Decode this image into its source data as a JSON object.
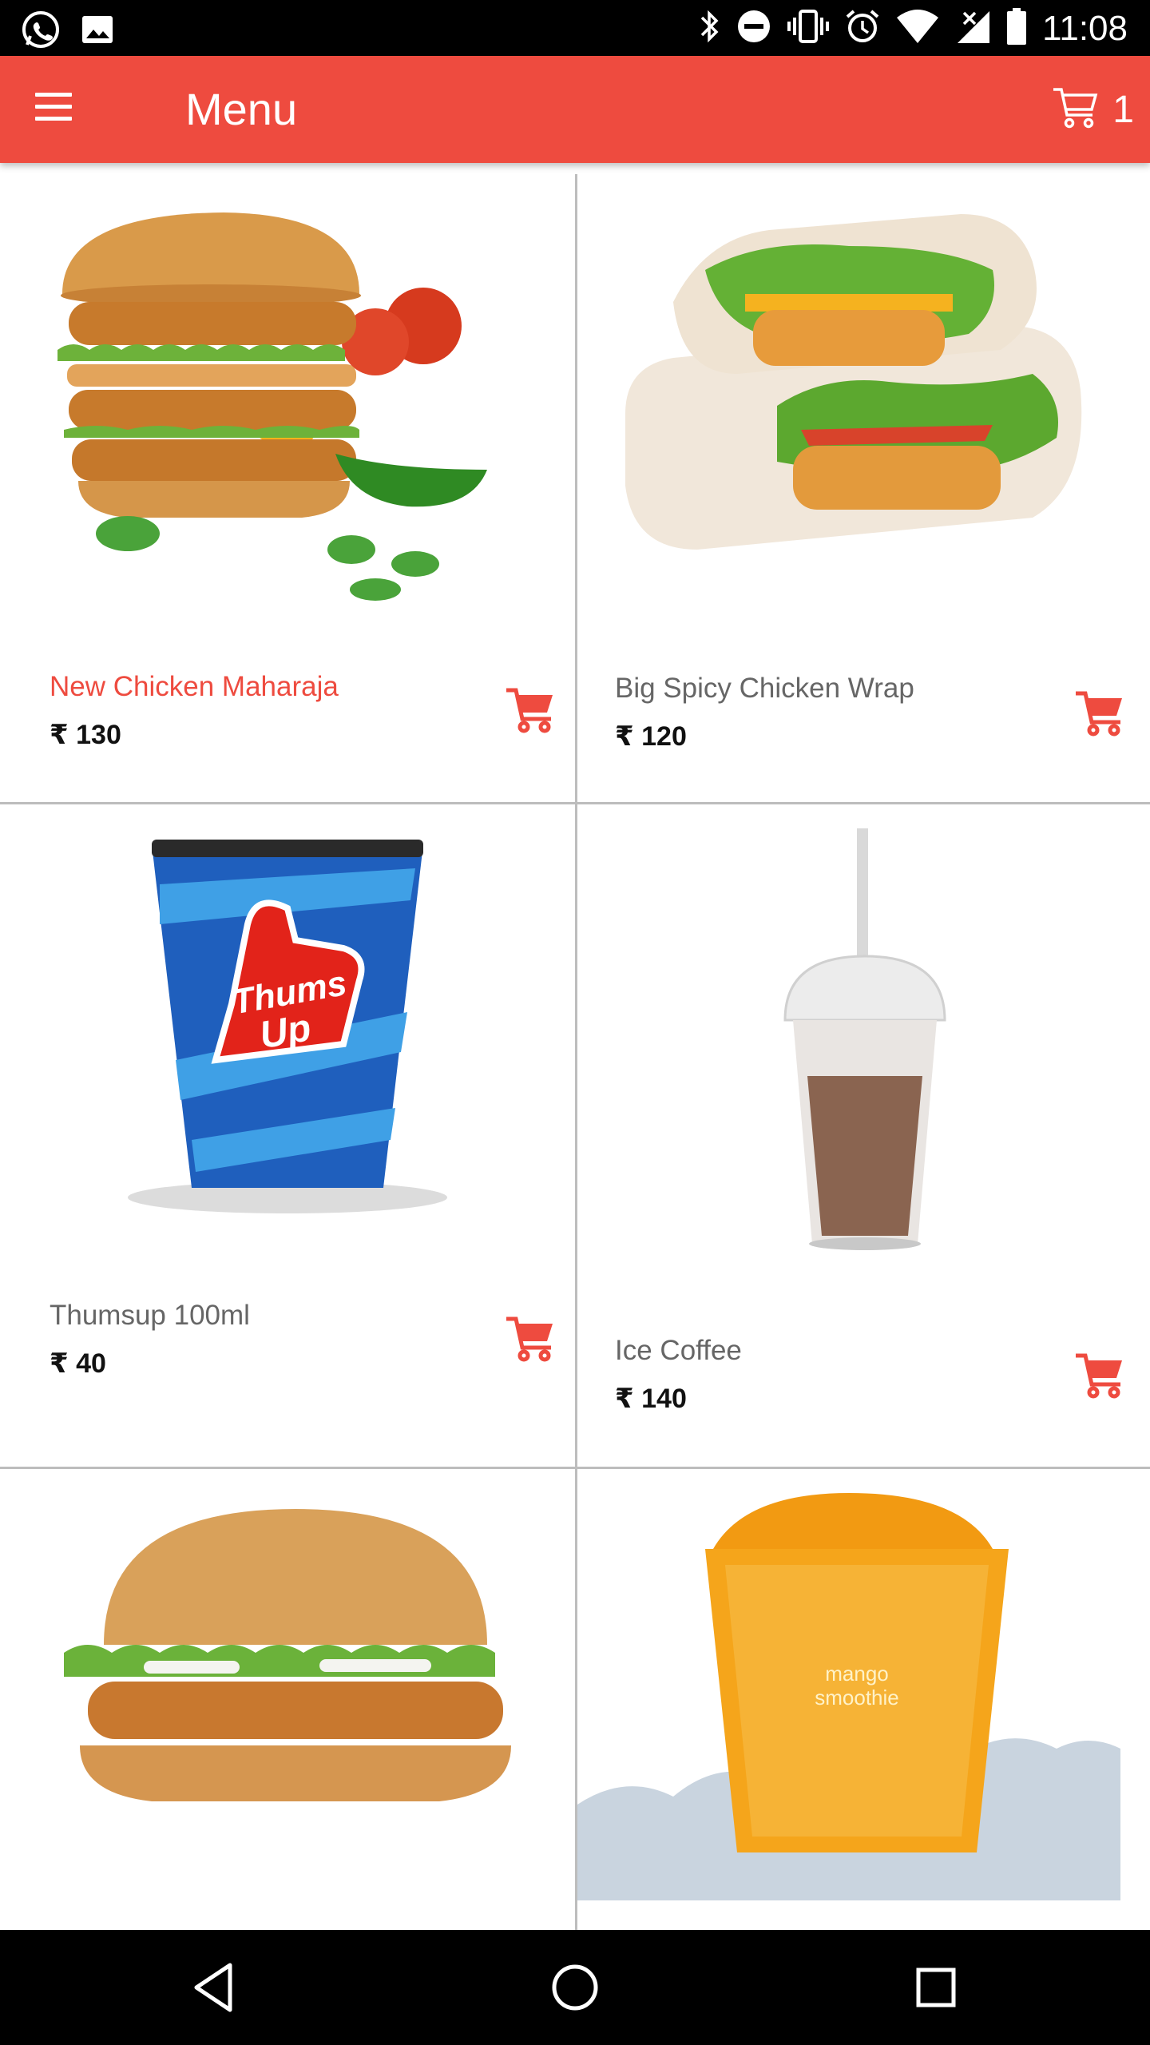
{
  "status_bar": {
    "time": "11:08",
    "left_icons": [
      "whatsapp-icon",
      "image-icon"
    ],
    "right_icons": [
      "bluetooth-icon",
      "do-not-disturb-icon",
      "vibrate-icon",
      "alarm-icon",
      "wifi-icon",
      "signal-icon",
      "battery-icon"
    ]
  },
  "app_bar": {
    "title": "Menu",
    "cart_count": "1",
    "color": "#ee4b3f"
  },
  "currency_symbol": "₹",
  "items": [
    {
      "name": "New Chicken Maharaja",
      "price": "130",
      "image": "burger-double-icon",
      "selected": true
    },
    {
      "name": "Big Spicy Chicken Wrap",
      "price": "120",
      "image": "wrap-icon",
      "selected": false
    },
    {
      "name": "Thumsup 100ml",
      "price": "40",
      "image": "cola-cup-icon",
      "cup_text_1": "Thums",
      "cup_text_2": "Up",
      "selected": false
    },
    {
      "name": "Ice Coffee",
      "price": "140",
      "image": "ice-coffee-icon",
      "selected": false
    },
    {
      "name": "",
      "price": "",
      "image": "chicken-burger-icon",
      "selected": false
    },
    {
      "name": "",
      "price": "",
      "image": "mango-smoothie-icon",
      "cup_text_1": "mango",
      "cup_text_2": "smoothie",
      "selected": false
    }
  ],
  "nav_bar": {
    "buttons": [
      "back-icon",
      "home-icon",
      "recents-icon"
    ]
  }
}
